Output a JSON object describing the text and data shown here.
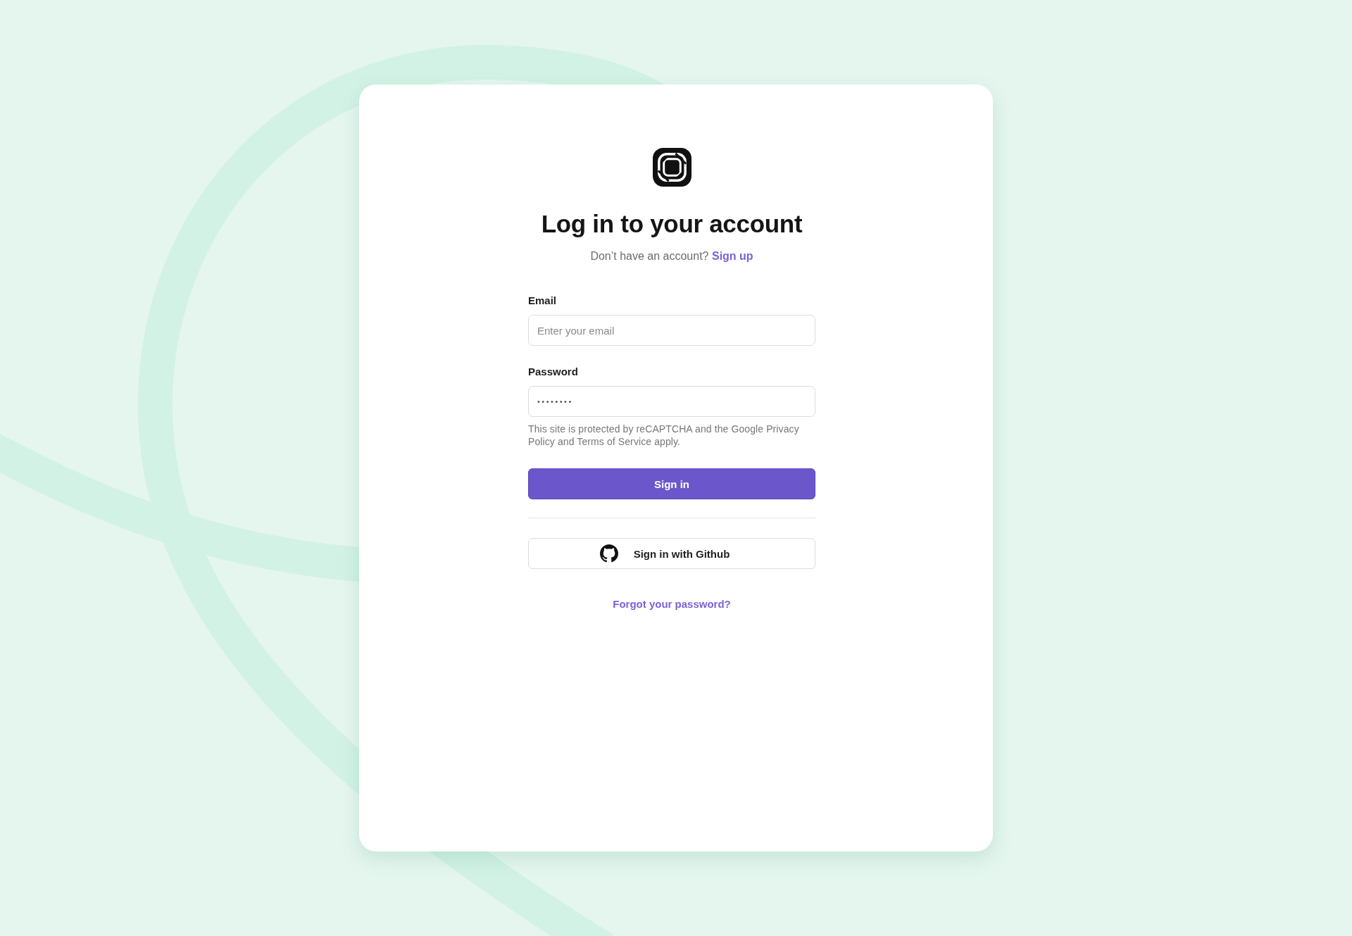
{
  "title": "Log in to your account",
  "signup_prompt": {
    "text": "Don’t have an account?",
    "link": "Sign up"
  },
  "fields": [
    {
      "label": "Email",
      "placeholder": "Enter your email"
    },
    {
      "label": "Password",
      "value": "••••••••"
    }
  ],
  "recaptcha_notice": "This site is protected by reCAPTCHA and the Google Privacy Policy and Terms of Service apply.",
  "primary_button": "Sign in",
  "github_button": "Sign in with Github",
  "forgot_password_link": "Forgot your password?"
}
